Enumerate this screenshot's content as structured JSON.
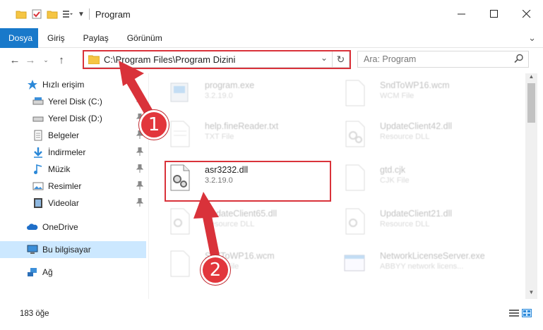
{
  "window": {
    "title": "Program"
  },
  "ribbon": {
    "tabs": [
      "Dosya",
      "Giriş",
      "Paylaş",
      "Görünüm"
    ]
  },
  "address": {
    "path": "C:\\Program Files\\Program Dizini"
  },
  "search": {
    "placeholder": "Ara: Program"
  },
  "sidebar": {
    "items": [
      {
        "label": "Hızlı erişim",
        "icon": "star-icon"
      },
      {
        "label": "Yerel Disk (C:)",
        "icon": "drive-icon"
      },
      {
        "label": "Yerel Disk (D:)",
        "icon": "drive-icon"
      },
      {
        "label": "Belgeler",
        "icon": "documents-icon"
      },
      {
        "label": "İndirmeler",
        "icon": "download-icon"
      },
      {
        "label": "Müzik",
        "icon": "music-icon"
      },
      {
        "label": "Resimler",
        "icon": "pictures-icon"
      },
      {
        "label": "Videolar",
        "icon": "video-icon"
      },
      {
        "label": "OneDrive",
        "icon": "cloud-icon"
      },
      {
        "label": "Bu bilgisayar",
        "icon": "computer-icon"
      },
      {
        "label": "Ağ",
        "icon": "network-icon"
      }
    ]
  },
  "files": [
    {
      "name": "program.exe",
      "sub": "3.2.19.0"
    },
    {
      "name": "SndToWP16.wcm",
      "sub": "WCM File"
    },
    {
      "name": "help.fineReader.txt",
      "sub": "TXT File"
    },
    {
      "name": "UpdateClient42.dll",
      "sub": "Resource DLL"
    },
    {
      "name": "asr3232.dll",
      "sub": "3.2.19.0"
    },
    {
      "name": "gtd.cjk",
      "sub": "CJK File"
    },
    {
      "name": "UpdateClient65.dll",
      "sub": "Resource DLL"
    },
    {
      "name": "UpdateClient21.dll",
      "sub": "Resource DLL"
    },
    {
      "name": "SndToWP16.wcm",
      "sub": "WCM File"
    },
    {
      "name": "NetworkLicenseServer.exe",
      "sub": "ABBYY network licens..."
    }
  ],
  "status": {
    "count": "183 öğe"
  },
  "annotations": {
    "step1": "1",
    "step2": "2"
  },
  "colors": {
    "accent": "#1979ca",
    "highlight": "#d9323a",
    "selected": "#cce8ff"
  }
}
